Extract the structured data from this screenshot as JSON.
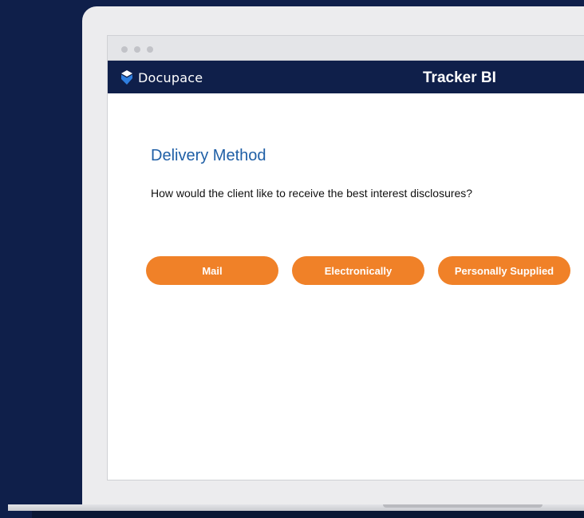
{
  "browser": {
    "window_controls": [
      "dot",
      "dot",
      "dot"
    ]
  },
  "app": {
    "brand_name": "Docupace",
    "brand_icon": "docupace-logo-icon",
    "title": "Tracker BI"
  },
  "content": {
    "heading": "Delivery Method",
    "question": "How would the client like to receive the best interest disclosures?",
    "options": [
      {
        "label": "Mail"
      },
      {
        "label": "Electronically"
      },
      {
        "label": "Personally Supplied"
      }
    ]
  },
  "colors": {
    "navy": "#0f1f4a",
    "accent_orange": "#f08128",
    "heading_blue": "#1f5fa6"
  }
}
